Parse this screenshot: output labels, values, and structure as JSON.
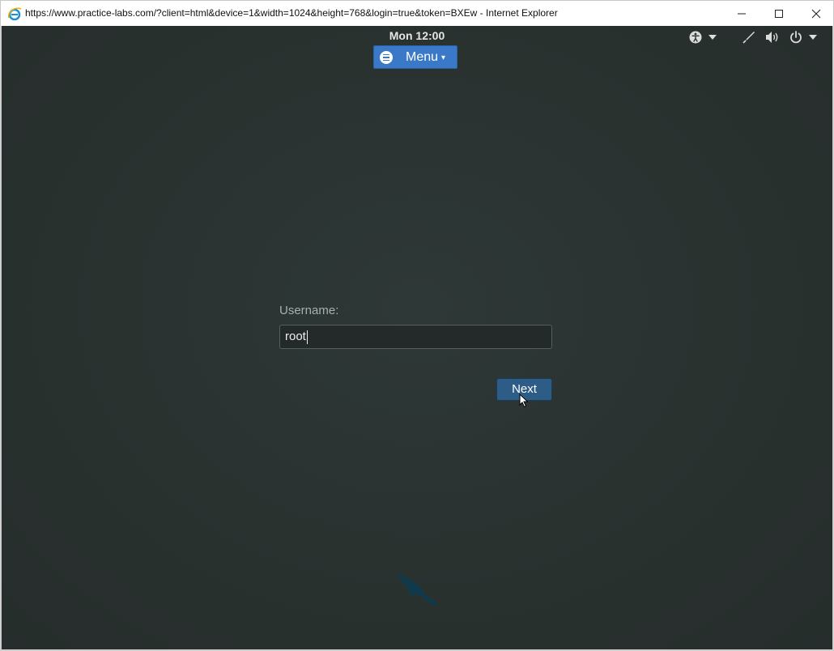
{
  "window": {
    "title": "https://www.practice-labs.com/?client=html&device=1&width=1024&height=768&login=true&token=BXEw - Internet Explorer",
    "icons": [
      "ie-logo-icon",
      "minimize-icon",
      "maximize-icon",
      "close-icon"
    ]
  },
  "topbar": {
    "clock": "Mon 12:00",
    "menu_label": "Menu",
    "menu_caret": "▾",
    "tray_icons": [
      "accessibility-icon",
      "chevron-down-icon",
      "pen-icon",
      "volume-icon",
      "power-icon",
      "chevron-down-icon"
    ]
  },
  "login": {
    "username_label": "Username:",
    "username_value": "root",
    "next_label": "Next"
  },
  "colors": {
    "desktop_bg": "#2a3332",
    "menu_accent": "#3a78c8",
    "next_button": "#2d5d87"
  }
}
